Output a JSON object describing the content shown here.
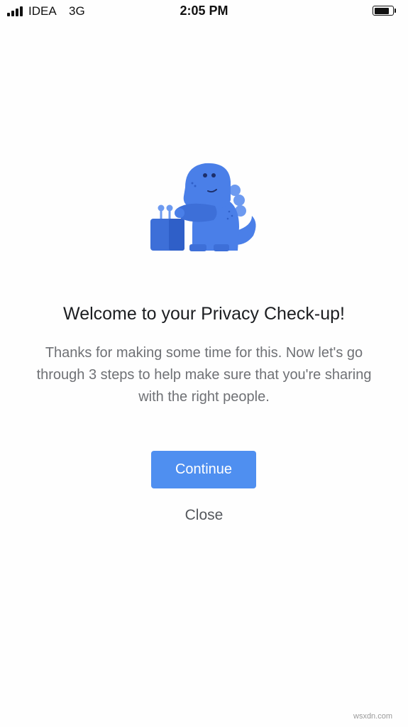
{
  "status_bar": {
    "carrier": "IDEA",
    "network": "3G",
    "time": "2:05 PM",
    "signal_bars": 4,
    "battery_level": 0.85
  },
  "illustration": {
    "icon": "dinosaur-mascot-icon",
    "color": "#4a7fe8"
  },
  "content": {
    "title": "Welcome to your Privacy Check-up!",
    "body": "Thanks for making some time for this. Now let's go through 3 steps to help make sure that you're sharing with the right people."
  },
  "actions": {
    "continue_label": "Continue",
    "close_label": "Close"
  },
  "watermark": "wsxdn.com",
  "colors": {
    "accent": "#4f8ff0",
    "mascot": "#4a7fe8"
  }
}
